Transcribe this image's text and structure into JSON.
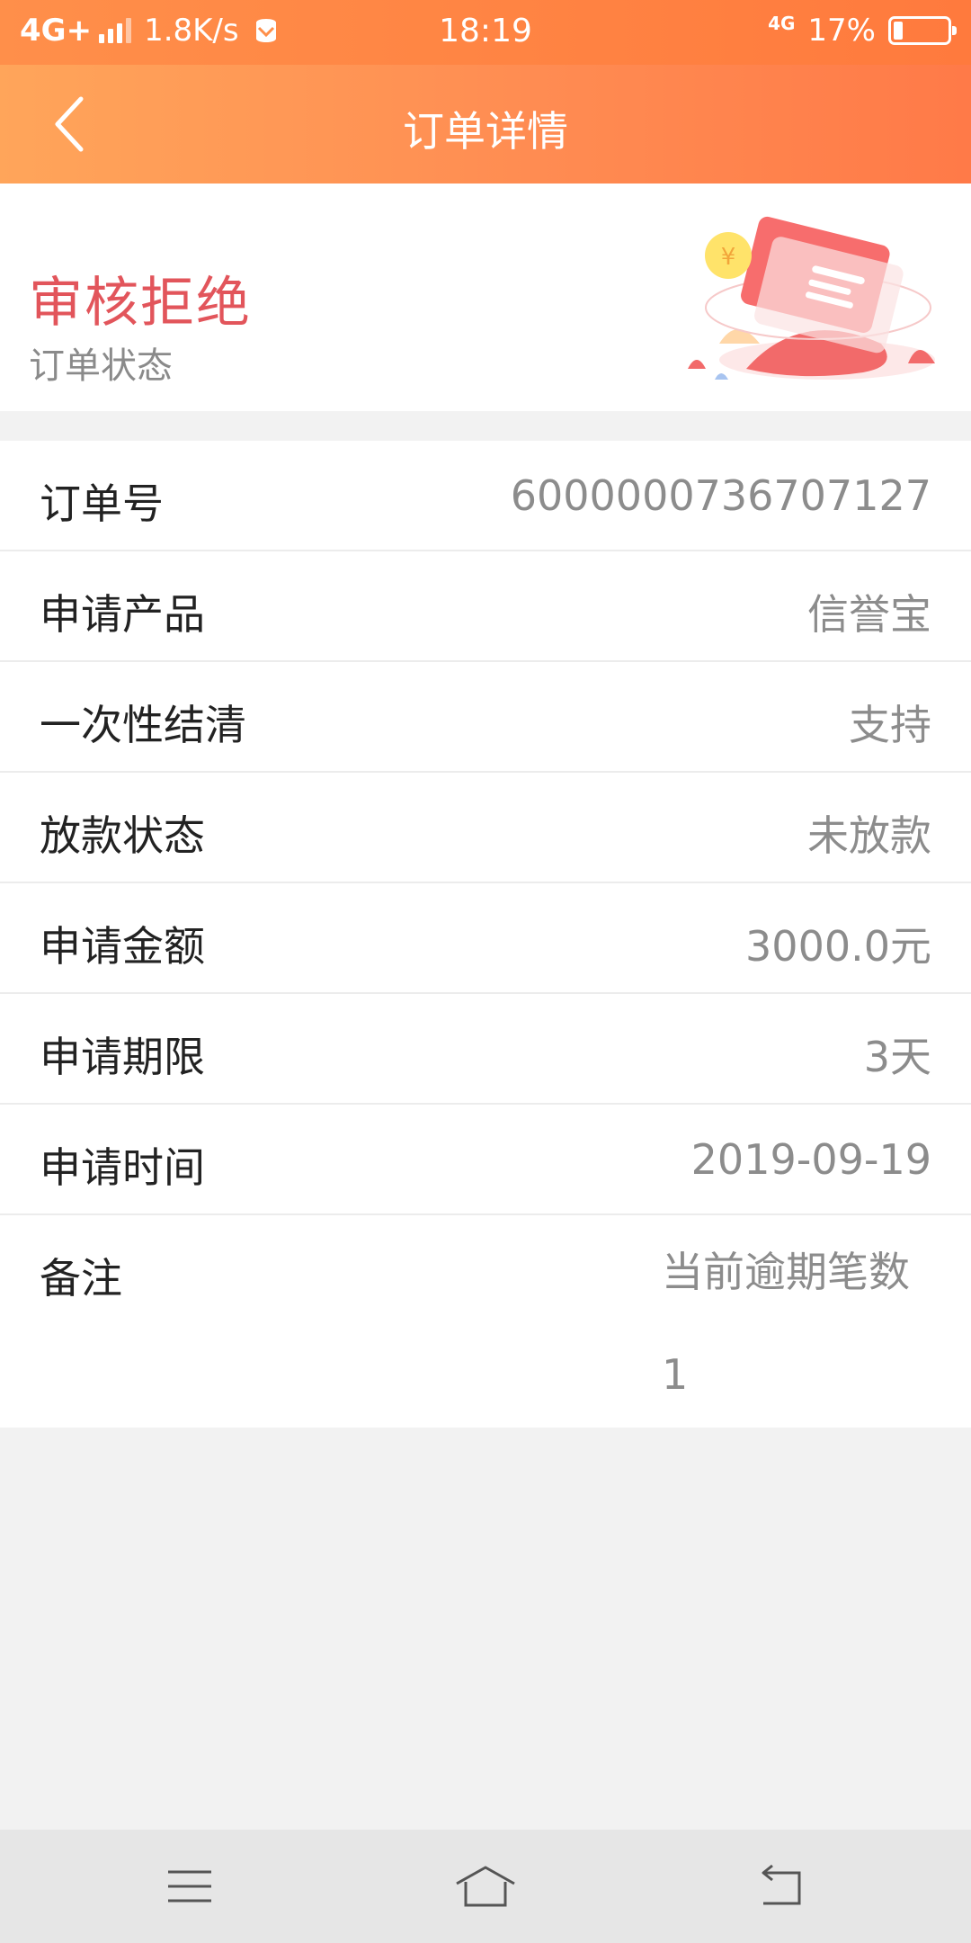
{
  "status_bar": {
    "network": "4G+",
    "speed": "1.8K/s",
    "time": "18:19",
    "network_right": "4G",
    "battery": "17%",
    "battery_level": 0.17
  },
  "header": {
    "title": "订单详情",
    "back_icon": "chevron-left-icon"
  },
  "order_status": {
    "value": "审核拒绝",
    "label": "订单状态",
    "value_color": "#e2555b"
  },
  "details": [
    {
      "label": "订单号",
      "value": "6000000736707127"
    },
    {
      "label": "申请产品",
      "value": "信誉宝"
    },
    {
      "label": "一次性结清",
      "value": "支持"
    },
    {
      "label": "放款状态",
      "value": "未放款"
    },
    {
      "label": "申请金额",
      "value": "3000.0元"
    },
    {
      "label": "申请期限",
      "value": "3天"
    },
    {
      "label": "申请时间",
      "value": "2019-09-19"
    }
  ],
  "note": {
    "label": "备注",
    "value": "当前逾期笔数\n1"
  },
  "nav": {
    "menu_icon": "menu-icon",
    "home_icon": "home-icon",
    "back_icon": "back-arrow-icon"
  },
  "colors": {
    "header_start": "#ffa55a",
    "header_end": "#ff7a48",
    "status_red": "#e2555b"
  }
}
